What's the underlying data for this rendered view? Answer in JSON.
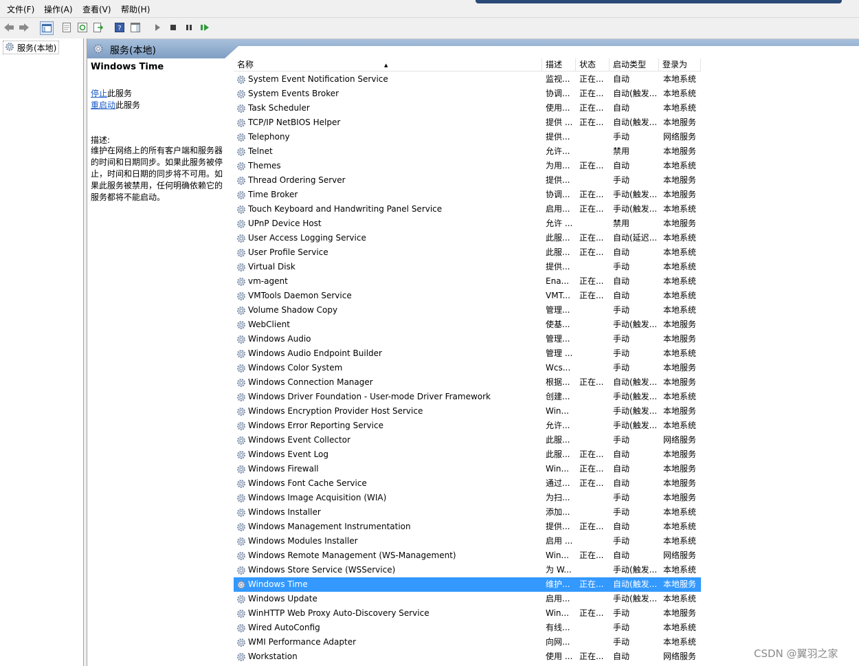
{
  "menu": {
    "file": "文件(F)",
    "action": "操作(A)",
    "view": "查看(V)",
    "help": "帮助(H)"
  },
  "tree": {
    "root": "服务(本地)"
  },
  "header": {
    "title": "服务(本地)"
  },
  "detail": {
    "service_name": "Windows Time",
    "stop_link": "停止",
    "stop_suffix": "此服务",
    "restart_link": "重启动",
    "restart_suffix": "此服务",
    "desc_label": "描述:",
    "desc_text": "维护在网络上的所有客户端和服务器的时间和日期同步。如果此服务被停止，时间和日期的同步将不可用。如果此服务被禁用，任何明确依赖它的服务都将不能启动。"
  },
  "columns": {
    "name": "名称",
    "desc": "描述",
    "status": "状态",
    "startup": "启动类型",
    "logon": "登录为"
  },
  "rows": [
    {
      "name": "System Event Notification Service",
      "desc": "监视...",
      "status": "正在...",
      "startup": "自动",
      "logon": "本地系统"
    },
    {
      "name": "System Events Broker",
      "desc": "协调...",
      "status": "正在...",
      "startup": "自动(触发...",
      "logon": "本地系统"
    },
    {
      "name": "Task Scheduler",
      "desc": "使用...",
      "status": "正在...",
      "startup": "自动",
      "logon": "本地系统"
    },
    {
      "name": "TCP/IP NetBIOS Helper",
      "desc": "提供 ...",
      "status": "正在...",
      "startup": "自动(触发...",
      "logon": "本地服务"
    },
    {
      "name": "Telephony",
      "desc": "提供...",
      "status": "",
      "startup": "手动",
      "logon": "网络服务"
    },
    {
      "name": "Telnet",
      "desc": "允许...",
      "status": "",
      "startup": "禁用",
      "logon": "本地服务"
    },
    {
      "name": "Themes",
      "desc": "为用...",
      "status": "正在...",
      "startup": "自动",
      "logon": "本地系统"
    },
    {
      "name": "Thread Ordering Server",
      "desc": "提供...",
      "status": "",
      "startup": "手动",
      "logon": "本地服务"
    },
    {
      "name": "Time Broker",
      "desc": "协调...",
      "status": "正在...",
      "startup": "手动(触发...",
      "logon": "本地服务"
    },
    {
      "name": "Touch Keyboard and Handwriting Panel Service",
      "desc": "启用...",
      "status": "正在...",
      "startup": "手动(触发...",
      "logon": "本地系统"
    },
    {
      "name": "UPnP Device Host",
      "desc": "允许 ...",
      "status": "",
      "startup": "禁用",
      "logon": "本地服务"
    },
    {
      "name": "User Access Logging Service",
      "desc": "此服...",
      "status": "正在...",
      "startup": "自动(延迟...",
      "logon": "本地系统"
    },
    {
      "name": "User Profile Service",
      "desc": "此服...",
      "status": "正在...",
      "startup": "自动",
      "logon": "本地系统"
    },
    {
      "name": "Virtual Disk",
      "desc": "提供...",
      "status": "",
      "startup": "手动",
      "logon": "本地系统"
    },
    {
      "name": "vm-agent",
      "desc": "Ena...",
      "status": "正在...",
      "startup": "自动",
      "logon": "本地系统"
    },
    {
      "name": "VMTools Daemon Service",
      "desc": "VMT...",
      "status": "正在...",
      "startup": "自动",
      "logon": "本地系统"
    },
    {
      "name": "Volume Shadow Copy",
      "desc": "管理...",
      "status": "",
      "startup": "手动",
      "logon": "本地系统"
    },
    {
      "name": "WebClient",
      "desc": "使基...",
      "status": "",
      "startup": "手动(触发...",
      "logon": "本地服务"
    },
    {
      "name": "Windows Audio",
      "desc": "管理...",
      "status": "",
      "startup": "手动",
      "logon": "本地服务"
    },
    {
      "name": "Windows Audio Endpoint Builder",
      "desc": "管理 ...",
      "status": "",
      "startup": "手动",
      "logon": "本地系统"
    },
    {
      "name": "Windows Color System",
      "desc": "Wcs...",
      "status": "",
      "startup": "手动",
      "logon": "本地服务"
    },
    {
      "name": "Windows Connection Manager",
      "desc": "根据...",
      "status": "正在...",
      "startup": "自动(触发...",
      "logon": "本地服务"
    },
    {
      "name": "Windows Driver Foundation - User-mode Driver Framework",
      "desc": "创建...",
      "status": "",
      "startup": "手动(触发...",
      "logon": "本地系统"
    },
    {
      "name": "Windows Encryption Provider Host Service",
      "desc": "Win...",
      "status": "",
      "startup": "手动(触发...",
      "logon": "本地服务"
    },
    {
      "name": "Windows Error Reporting Service",
      "desc": "允许...",
      "status": "",
      "startup": "手动(触发...",
      "logon": "本地系统"
    },
    {
      "name": "Windows Event Collector",
      "desc": "此服...",
      "status": "",
      "startup": "手动",
      "logon": "网络服务"
    },
    {
      "name": "Windows Event Log",
      "desc": "此服...",
      "status": "正在...",
      "startup": "自动",
      "logon": "本地服务"
    },
    {
      "name": "Windows Firewall",
      "desc": "Win...",
      "status": "正在...",
      "startup": "自动",
      "logon": "本地服务"
    },
    {
      "name": "Windows Font Cache Service",
      "desc": "通过...",
      "status": "正在...",
      "startup": "自动",
      "logon": "本地服务"
    },
    {
      "name": "Windows Image Acquisition (WIA)",
      "desc": "为扫...",
      "status": "",
      "startup": "手动",
      "logon": "本地服务"
    },
    {
      "name": "Windows Installer",
      "desc": "添加...",
      "status": "",
      "startup": "手动",
      "logon": "本地系统"
    },
    {
      "name": "Windows Management Instrumentation",
      "desc": "提供...",
      "status": "正在...",
      "startup": "自动",
      "logon": "本地系统"
    },
    {
      "name": "Windows Modules Installer",
      "desc": "启用 ...",
      "status": "",
      "startup": "手动",
      "logon": "本地系统"
    },
    {
      "name": "Windows Remote Management (WS-Management)",
      "desc": "Win...",
      "status": "正在...",
      "startup": "自动",
      "logon": "网络服务"
    },
    {
      "name": "Windows Store Service (WSService)",
      "desc": "为 W...",
      "status": "",
      "startup": "手动(触发...",
      "logon": "本地系统"
    },
    {
      "name": "Windows Time",
      "desc": "维护...",
      "status": "正在...",
      "startup": "自动(触发...",
      "logon": "本地服务",
      "selected": true
    },
    {
      "name": "Windows Update",
      "desc": "启用...",
      "status": "",
      "startup": "手动(触发...",
      "logon": "本地系统"
    },
    {
      "name": "WinHTTP Web Proxy Auto-Discovery Service",
      "desc": "Win...",
      "status": "正在...",
      "startup": "手动",
      "logon": "本地服务"
    },
    {
      "name": "Wired AutoConfig",
      "desc": "有线...",
      "status": "",
      "startup": "手动",
      "logon": "本地系统"
    },
    {
      "name": "WMI Performance Adapter",
      "desc": "向网...",
      "status": "",
      "startup": "手动",
      "logon": "本地系统"
    },
    {
      "name": "Workstation",
      "desc": "使用 ...",
      "status": "正在...",
      "startup": "自动",
      "logon": "网络服务"
    }
  ],
  "watermark": "CSDN @翼羽之家",
  "colors": {
    "selection": "#3399ff",
    "link": "#1a5bc6",
    "header_gradient_top": "#a8c0dc",
    "header_gradient_bottom": "#7f9ec3"
  }
}
